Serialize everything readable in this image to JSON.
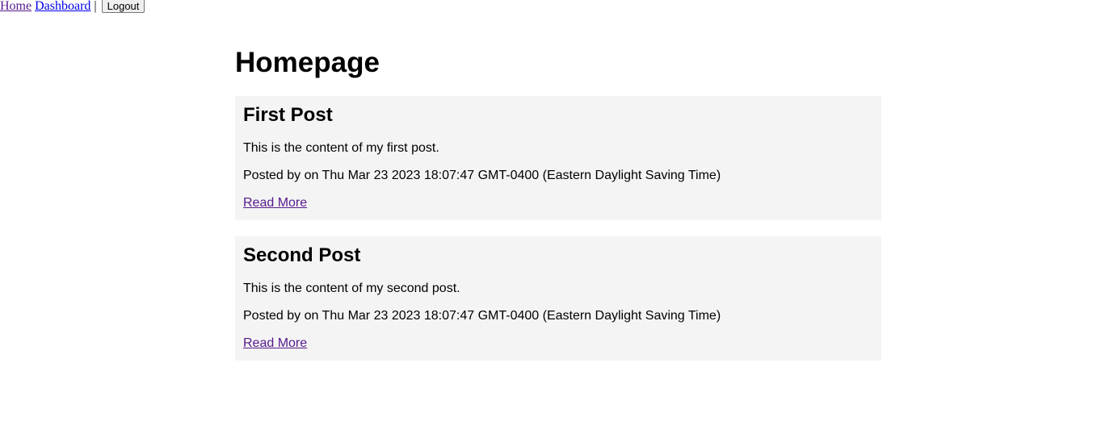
{
  "nav": {
    "home_label": "Home",
    "dashboard_label": "Dashboard",
    "separator": "|",
    "logout_label": "Logout"
  },
  "main": {
    "title": "Homepage"
  },
  "posts": [
    {
      "title": "First Post",
      "content": "This is the content of my first post.",
      "meta": "Posted by on Thu Mar 23 2023 18:07:47 GMT-0400 (Eastern Daylight Saving Time)",
      "read_more_label": "Read More"
    },
    {
      "title": "Second Post",
      "content": "This is the content of my second post.",
      "meta": "Posted by on Thu Mar 23 2023 18:07:47 GMT-0400 (Eastern Daylight Saving Time)",
      "read_more_label": "Read More"
    }
  ],
  "colors": {
    "visited_link": "#551a8b",
    "link": "#0000ee",
    "post_background": "#f4f4f4"
  }
}
